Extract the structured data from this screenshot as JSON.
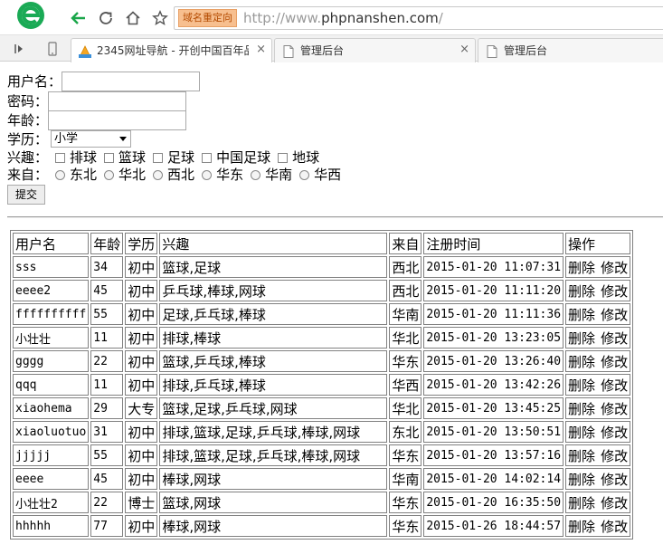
{
  "browser": {
    "redirect_badge": "域名重定向",
    "url_prefix": "http://www.",
    "url_host": "phpnanshen.com",
    "url_suffix": "/",
    "tabs": [
      {
        "label": "2345网址导航 - 开创中国百年品",
        "active": true
      },
      {
        "label": "管理后台",
        "active": false
      },
      {
        "label": "管理后台",
        "active": false
      }
    ],
    "tab_close_glyph": "×",
    "colors": {
      "logo_green": "#1aaa55",
      "back_green": "#1aa64a"
    }
  },
  "form": {
    "username_label": "用户名：",
    "password_label": "密码：",
    "age_label": "年龄：",
    "education_label": "学历：",
    "education_selected": "小学",
    "hobby_label": "兴趣：",
    "hobbies": [
      "排球",
      "篮球",
      "足球",
      "中国足球",
      "地球"
    ],
    "from_label": "来自：",
    "regions": [
      "东北",
      "华北",
      "西北",
      "华东",
      "华南",
      "华西"
    ],
    "submit_label": "提交"
  },
  "table": {
    "headers": [
      "用户名",
      "年龄",
      "学历",
      "兴趣",
      "来自",
      "注册时间",
      "操作"
    ],
    "delete_label": "删除",
    "edit_label": "修改",
    "rows": [
      [
        "sss",
        "34",
        "初中",
        "篮球,足球",
        "西北",
        "2015-01-20 11:07:31"
      ],
      [
        "eeee2",
        "45",
        "初中",
        "乒乓球,棒球,网球",
        "西北",
        "2015-01-20 11:11:20"
      ],
      [
        "ffffffffff",
        "55",
        "初中",
        "足球,乒乓球,棒球",
        "华南",
        "2015-01-20 11:11:36"
      ],
      [
        "小壮壮",
        "11",
        "初中",
        "排球,棒球",
        "华北",
        "2015-01-20 13:23:05"
      ],
      [
        "gggg",
        "22",
        "初中",
        "篮球,乒乓球,棒球",
        "华东",
        "2015-01-20 13:26:40"
      ],
      [
        "qqq",
        "11",
        "初中",
        "排球,乒乓球,棒球",
        "华西",
        "2015-01-20 13:42:26"
      ],
      [
        "xiaohema",
        "29",
        "大专",
        "篮球,足球,乒乓球,网球",
        "华北",
        "2015-01-20 13:45:25"
      ],
      [
        "xiaoluotuo",
        "31",
        "初中",
        "排球,篮球,足球,乒乓球,棒球,网球",
        "东北",
        "2015-01-20 13:50:51"
      ],
      [
        "jjjjj",
        "55",
        "初中",
        "排球,篮球,足球,乒乓球,棒球,网球",
        "华东",
        "2015-01-20 13:57:16"
      ],
      [
        "eeee",
        "45",
        "初中",
        "棒球,网球",
        "华南",
        "2015-01-20 14:02:14"
      ],
      [
        "小壮壮2",
        "22",
        "博士",
        "篮球,网球",
        "华东",
        "2015-01-20 16:35:50"
      ],
      [
        "hhhhh",
        "77",
        "初中",
        "棒球,网球",
        "华东",
        "2015-01-26 18:44:57"
      ]
    ]
  }
}
